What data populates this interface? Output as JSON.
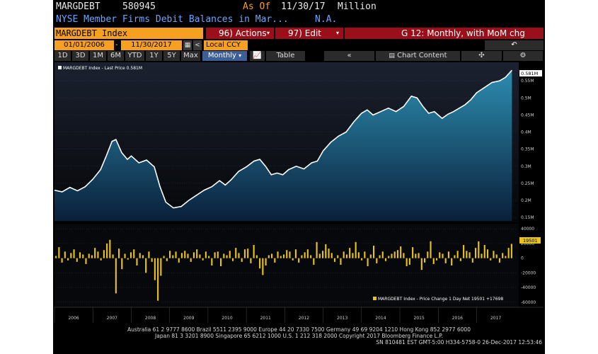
{
  "header": {
    "ticker": "MARGDEBT",
    "code": "580945",
    "as_of_label": "As Of",
    "as_of_date": "11/30/17",
    "unit": "Million",
    "description": "NYSE Member Firms Debit Balances in Mar...",
    "na": "N.A."
  },
  "toolbar": {
    "security": "MARGDEBT Index",
    "actions_label": "96) Actions",
    "edit_label": "97) Edit",
    "graph_label": "G 12: Monthly, with MoM chg",
    "start_date": "01/01/2006",
    "end_date": "11/30/2017",
    "currency": "Local CCY"
  },
  "periods": [
    "1D",
    "3D",
    "1M",
    "6M",
    "YTD",
    "1Y",
    "5Y",
    "Max"
  ],
  "frequency": "Monthly",
  "table_label": "Table",
  "chart_content_label": "Chart Content",
  "chart_data": [
    {
      "type": "area",
      "legend": "MARGDEBT Index - Last Price 0.581M",
      "last_value_label": "0.581M",
      "y_unit": "M",
      "ylim": [
        0.14,
        0.6
      ],
      "y_ticks": [
        0.15,
        0.2,
        0.25,
        0.3,
        0.35,
        0.4,
        0.45,
        0.5,
        0.55
      ],
      "x_start": "2006-01",
      "x_end": "2017-11",
      "x_tick_labels": [
        "2006",
        "2007",
        "2008",
        "2009",
        "2010",
        "2011",
        "2012",
        "2013",
        "2014",
        "2015",
        "2016",
        "2017"
      ],
      "points": [
        [
          2006.0,
          0.23
        ],
        [
          2006.2,
          0.225
        ],
        [
          2006.4,
          0.238
        ],
        [
          2006.6,
          0.228
        ],
        [
          2006.8,
          0.24
        ],
        [
          2007.0,
          0.262
        ],
        [
          2007.2,
          0.29
        ],
        [
          2007.35,
          0.33
        ],
        [
          2007.5,
          0.373
        ],
        [
          2007.6,
          0.378
        ],
        [
          2007.75,
          0.34
        ],
        [
          2007.9,
          0.32
        ],
        [
          2008.0,
          0.33
        ],
        [
          2008.2,
          0.31
        ],
        [
          2008.4,
          0.318
        ],
        [
          2008.6,
          0.298
        ],
        [
          2008.75,
          0.24
        ],
        [
          2008.9,
          0.195
        ],
        [
          2009.1,
          0.178
        ],
        [
          2009.3,
          0.182
        ],
        [
          2009.5,
          0.2
        ],
        [
          2009.7,
          0.215
        ],
        [
          2009.9,
          0.23
        ],
        [
          2010.1,
          0.24
        ],
        [
          2010.3,
          0.258
        ],
        [
          2010.45,
          0.245
        ],
        [
          2010.6,
          0.26
        ],
        [
          2010.8,
          0.285
        ],
        [
          2011.0,
          0.298
        ],
        [
          2011.2,
          0.315
        ],
        [
          2011.35,
          0.32
        ],
        [
          2011.5,
          0.3
        ],
        [
          2011.65,
          0.275
        ],
        [
          2011.8,
          0.28
        ],
        [
          2011.95,
          0.275
        ],
        [
          2012.1,
          0.29
        ],
        [
          2012.3,
          0.3
        ],
        [
          2012.5,
          0.292
        ],
        [
          2012.7,
          0.31
        ],
        [
          2012.85,
          0.315
        ],
        [
          2013.0,
          0.345
        ],
        [
          2013.2,
          0.37
        ],
        [
          2013.4,
          0.388
        ],
        [
          2013.6,
          0.4
        ],
        [
          2013.8,
          0.43
        ],
        [
          2014.0,
          0.455
        ],
        [
          2014.15,
          0.465
        ],
        [
          2014.3,
          0.45
        ],
        [
          2014.5,
          0.46
        ],
        [
          2014.7,
          0.47
        ],
        [
          2014.9,
          0.46
        ],
        [
          2015.1,
          0.475
        ],
        [
          2015.3,
          0.505
        ],
        [
          2015.45,
          0.5
        ],
        [
          2015.6,
          0.475
        ],
        [
          2015.75,
          0.455
        ],
        [
          2015.9,
          0.46
        ],
        [
          2016.1,
          0.44
        ],
        [
          2016.25,
          0.452
        ],
        [
          2016.4,
          0.46
        ],
        [
          2016.55,
          0.47
        ],
        [
          2016.7,
          0.48
        ],
        [
          2016.85,
          0.495
        ],
        [
          2017.0,
          0.515
        ],
        [
          2017.2,
          0.53
        ],
        [
          2017.4,
          0.545
        ],
        [
          2017.6,
          0.55
        ],
        [
          2017.75,
          0.56
        ],
        [
          2017.92,
          0.581
        ]
      ]
    },
    {
      "type": "bar",
      "legend": "MARGDEBT Index - Price Change 1 Day Net 19501 +17698",
      "last_value_label": "19501",
      "ylim": [
        -65000,
        45000
      ],
      "y_ticks": [
        40000,
        20000,
        0,
        -20000,
        -40000,
        -60000
      ],
      "y_tick_labels": [
        "40000",
        "20000",
        "0",
        "-20000",
        "-40000",
        "-60000"
      ],
      "x_start": "2006-01",
      "values": [
        3000,
        15000,
        -6000,
        9000,
        -3000,
        7000,
        12000,
        -5000,
        8000,
        5000,
        -8000,
        6000,
        4000,
        14000,
        9000,
        -3000,
        11000,
        20000,
        25000,
        5000,
        -48000,
        13000,
        -15000,
        6000,
        -2000,
        8000,
        12000,
        -10000,
        7000,
        4000,
        -20000,
        9000,
        -5000,
        -30000,
        -58000,
        -24000,
        3000,
        -4000,
        10000,
        4000,
        9000,
        -6000,
        7000,
        10000,
        6000,
        -5000,
        8000,
        12000,
        5000,
        -3000,
        9000,
        3000,
        -10000,
        8000,
        9000,
        -11000,
        6000,
        4000,
        10000,
        -4000,
        14000,
        7000,
        -5000,
        12000,
        13000,
        -7000,
        18000,
        4000,
        -14000,
        -23000,
        -10000,
        4000,
        6000,
        -6000,
        9000,
        3000,
        5000,
        11000,
        9000,
        -3000,
        12000,
        -6000,
        4000,
        8000,
        12000,
        4000,
        -9000,
        22000,
        6000,
        10000,
        19000,
        13000,
        7000,
        -5000,
        4000,
        -9000,
        9000,
        5000,
        14000,
        7000,
        22000,
        8000,
        -3000,
        9000,
        -11000,
        5000,
        17000,
        -7000,
        4000,
        9000,
        -4000,
        3000,
        6000,
        9000,
        11000,
        16000,
        7000,
        -11000,
        -9000,
        15000,
        6000,
        7000,
        -16000,
        -6000,
        9000,
        23000,
        -8000,
        -3000,
        8000,
        6000,
        -7000,
        9000,
        -10000,
        4000,
        10000,
        -4000,
        18000,
        10000,
        8000,
        -6000,
        14000,
        23000,
        6000,
        18000,
        12000,
        -3000,
        10000,
        5000,
        -6000,
        7000,
        3000,
        14000,
        19501
      ]
    }
  ],
  "footer": {
    "line1": "Australia 61 2 9777 8600 Brazil 5511 2395 9000 Europe 44 20 7330 7500 Germany 49 69 9204 1210 Hong Kong 852 2977 6000",
    "line2": "Japan 81 3 3201 8900       Singapore 65 6212 1000       U.S. 1 212 318 2000       Copyright 2017 Bloomberg Finance L.P.",
    "line3": "SN 810481 EST  GMT-5:00 H334-5758-0 26-Dec-2017 12:53:46"
  },
  "colors": {
    "background": "#000000",
    "header_orange": "#f6a021",
    "action_red": "#9b0f1a",
    "line": "#ffffff",
    "area_top": "#2c8db0",
    "bar": "#e8c31c"
  }
}
